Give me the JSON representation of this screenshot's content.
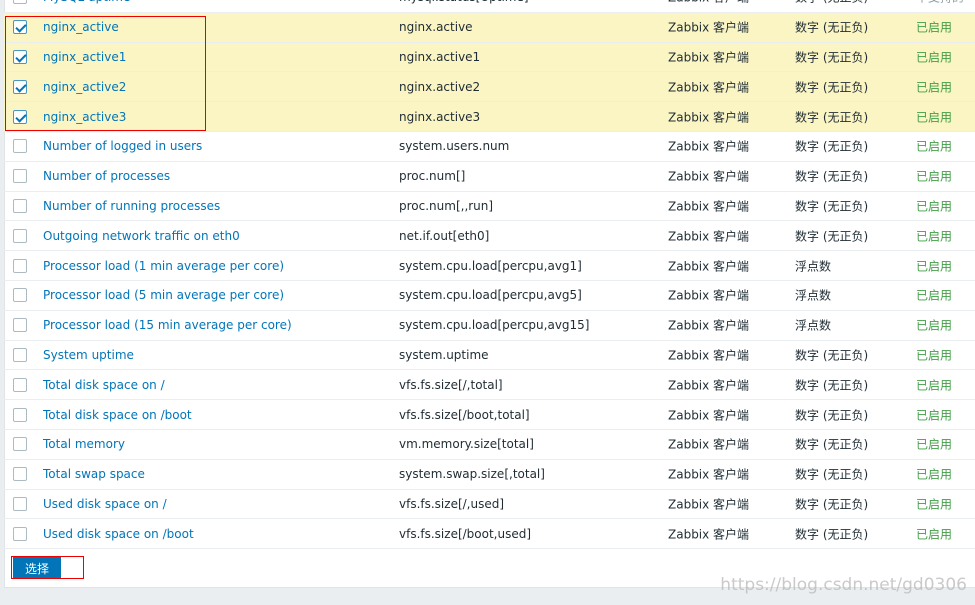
{
  "items": [
    {
      "name": "MySQL uptime",
      "key": "mysql.status[Uptime]",
      "type": "Zabbix 客户端",
      "info": "数字 (无正负)",
      "status": "不支持的",
      "checked": false
    },
    {
      "name": "nginx_active",
      "key": "nginx.active",
      "type": "Zabbix 客户端",
      "info": "数字 (无正负)",
      "status": "已启用",
      "checked": true
    },
    {
      "name": "nginx_active1",
      "key": "nginx.active1",
      "type": "Zabbix 客户端",
      "info": "数字 (无正负)",
      "status": "已启用",
      "checked": true
    },
    {
      "name": "nginx_active2",
      "key": "nginx.active2",
      "type": "Zabbix 客户端",
      "info": "数字 (无正负)",
      "status": "已启用",
      "checked": true
    },
    {
      "name": "nginx_active3",
      "key": "nginx.active3",
      "type": "Zabbix 客户端",
      "info": "数字 (无正负)",
      "status": "已启用",
      "checked": true
    },
    {
      "name": "Number of logged in users",
      "key": "system.users.num",
      "type": "Zabbix 客户端",
      "info": "数字 (无正负)",
      "status": "已启用",
      "checked": false
    },
    {
      "name": "Number of processes",
      "key": "proc.num[]",
      "type": "Zabbix 客户端",
      "info": "数字 (无正负)",
      "status": "已启用",
      "checked": false
    },
    {
      "name": "Number of running processes",
      "key": "proc.num[,,run]",
      "type": "Zabbix 客户端",
      "info": "数字 (无正负)",
      "status": "已启用",
      "checked": false
    },
    {
      "name": "Outgoing network traffic on eth0",
      "key": "net.if.out[eth0]",
      "type": "Zabbix 客户端",
      "info": "数字 (无正负)",
      "status": "已启用",
      "checked": false
    },
    {
      "name": "Processor load (1 min average per core)",
      "key": "system.cpu.load[percpu,avg1]",
      "type": "Zabbix 客户端",
      "info": "浮点数",
      "status": "已启用",
      "checked": false
    },
    {
      "name": "Processor load (5 min average per core)",
      "key": "system.cpu.load[percpu,avg5]",
      "type": "Zabbix 客户端",
      "info": "浮点数",
      "status": "已启用",
      "checked": false
    },
    {
      "name": "Processor load (15 min average per core)",
      "key": "system.cpu.load[percpu,avg15]",
      "type": "Zabbix 客户端",
      "info": "浮点数",
      "status": "已启用",
      "checked": false
    },
    {
      "name": "System uptime",
      "key": "system.uptime",
      "type": "Zabbix 客户端",
      "info": "数字 (无正负)",
      "status": "已启用",
      "checked": false
    },
    {
      "name": "Total disk space on /",
      "key": "vfs.fs.size[/,total]",
      "type": "Zabbix 客户端",
      "info": "数字 (无正负)",
      "status": "已启用",
      "checked": false
    },
    {
      "name": "Total disk space on /boot",
      "key": "vfs.fs.size[/boot,total]",
      "type": "Zabbix 客户端",
      "info": "数字 (无正负)",
      "status": "已启用",
      "checked": false
    },
    {
      "name": "Total memory",
      "key": "vm.memory.size[total]",
      "type": "Zabbix 客户端",
      "info": "数字 (无正负)",
      "status": "已启用",
      "checked": false
    },
    {
      "name": "Total swap space",
      "key": "system.swap.size[,total]",
      "type": "Zabbix 客户端",
      "info": "数字 (无正负)",
      "status": "已启用",
      "checked": false
    },
    {
      "name": "Used disk space on /",
      "key": "vfs.fs.size[/,used]",
      "type": "Zabbix 客户端",
      "info": "数字 (无正负)",
      "status": "已启用",
      "checked": false
    },
    {
      "name": "Used disk space on /boot",
      "key": "vfs.fs.size[/boot,used]",
      "type": "Zabbix 客户端",
      "info": "数字 (无正负)",
      "status": "已启用",
      "checked": false
    }
  ],
  "select_button": "选择",
  "watermark": "https://blog.csdn.net/gd0306",
  "colors": {
    "link": "#0275b8",
    "enabled": "#429e47",
    "selected_row": "#fbf5c4",
    "highlight_box": "#e00000"
  }
}
